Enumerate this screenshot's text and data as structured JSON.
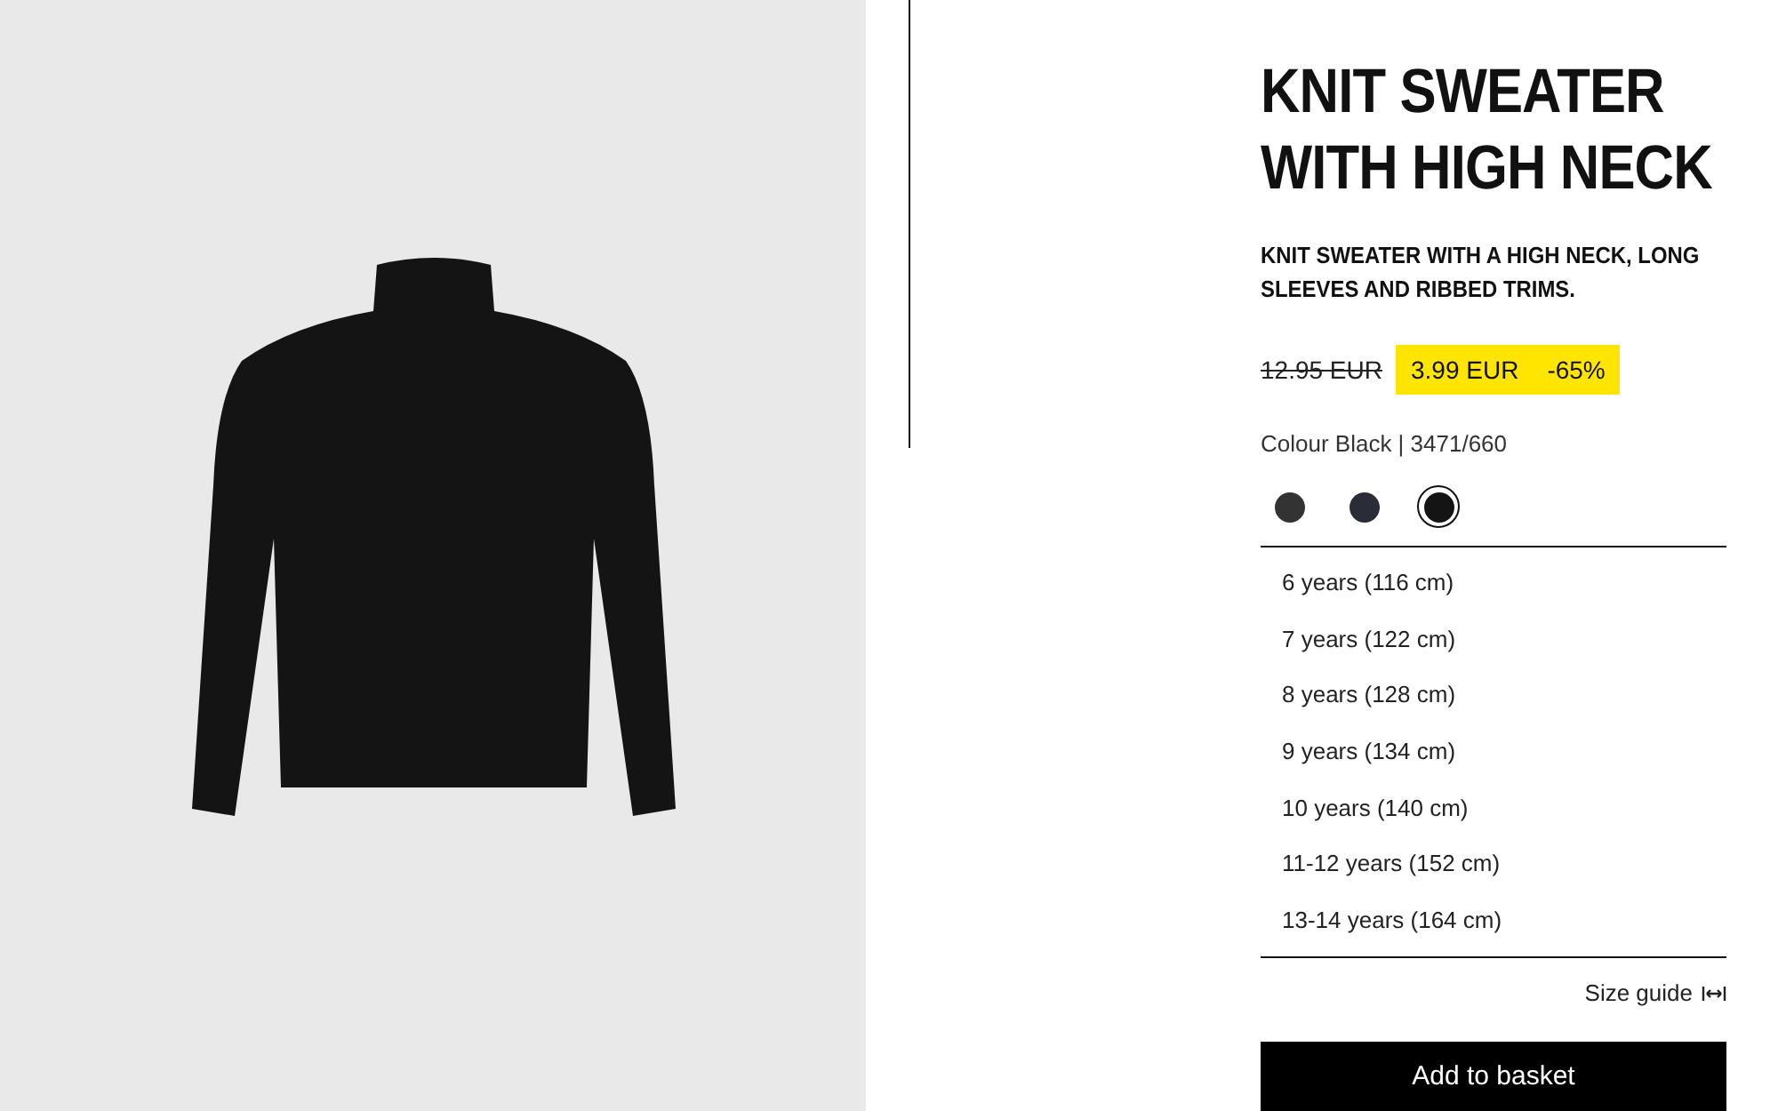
{
  "product": {
    "title": "KNIT SWEATER WITH HIGH NECK",
    "description": "KNIT SWEATER WITH A HIGH NECK, LONG SLEEVES AND RIBBED TRIMS.",
    "old_price": "12.95 EUR",
    "price": "3.99 EUR",
    "discount": "-65%",
    "colour_label": "Colour Black | 3471/660"
  },
  "colours": [
    {
      "color": "#333333",
      "selected": false
    },
    {
      "color": "#2a2d38",
      "selected": false
    },
    {
      "color": "#141414",
      "selected": true
    }
  ],
  "sizes": [
    "6 years (116 cm)",
    "7 years (122 cm)",
    "8 years (128 cm)",
    "9 years (134 cm)",
    "10 years (140 cm)",
    "11-12 years (152 cm)",
    "13-14 years (164 cm)"
  ],
  "size_guide": "Size guide",
  "add_button": "Add to basket"
}
